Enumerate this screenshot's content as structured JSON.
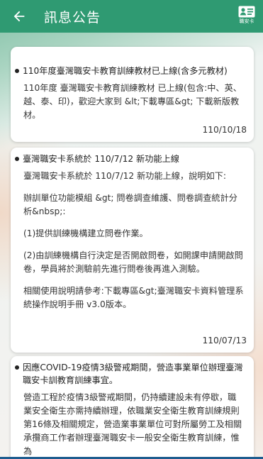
{
  "header": {
    "title": "訊息公告",
    "back_label": "←",
    "card_icon_label": "職安卡"
  },
  "announcements": [
    {
      "title": "110年度臺灣職安卡教育訓練教材已上線(含多元教材)",
      "paragraphs": [
        "110年度 臺灣職安卡教育訓練教材 已上線(包含:中、英、越、泰、印)，歡迎大家到 &lt;下載專區&gt; 下載新版教材。"
      ],
      "date": "110/10/18"
    },
    {
      "title": "臺灣職安卡系統於 110/7/12 新功能上線",
      "paragraphs": [
        "臺灣職安卡系統於 110/7/12 新功能上線，說明如下:",
        "辦訓單位功能模組 &gt; 問卷調查維護、問卷調查統計分析&nbsp;:",
        "(1)提供訓練機構建立問卷作業。",
        "(2)由訓練機構自行決定是否開啟問卷，如開課申請開啟問卷，學員將於測驗前先進行問卷後再進入測驗。",
        "相關使用說明請參考:下載專區&gt;臺灣職安卡資料管理系統操作說明手冊 v3.0版本。"
      ],
      "date": "110/07/13"
    },
    {
      "title": "因應COVID-19疫情3級警戒期間，營造事業單位辦理臺灣職安卡訓教育訓練事宜。",
      "paragraphs": [
        "營造工程於疫情3級警戒期間，仍持續建設未有停歇，職業安全衛生亦需持續辦理，依職業安全衛生教育訓練規則第16條及相關規定，營造業事業單位可對所屬勞工及相關承攬商工作者辦理臺灣職安卡一般安全衛生教育訓練，惟為"
      ],
      "date": ""
    }
  ],
  "colors": {
    "appbar": "#2f9a72",
    "accent_bottom": "#1d5c8f"
  }
}
